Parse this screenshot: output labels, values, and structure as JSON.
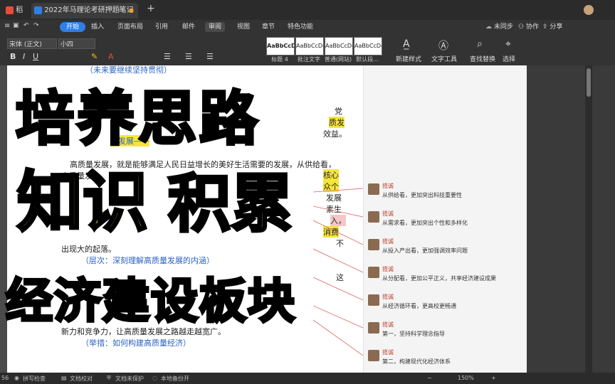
{
  "titlebar": {
    "home_tab": "稻壳",
    "doc_tab": "2022年马理论考研押题笔记",
    "new_tab": "+"
  },
  "menubar": {
    "items": [
      "开始",
      "插入",
      "页面布局",
      "引用",
      "邮件",
      "审阅",
      "视图",
      "章节",
      "特色功能"
    ],
    "right": {
      "sync": "未同步",
      "collab": "协作",
      "share": "分享"
    }
  },
  "toolbar": {
    "font_name": "宋体 (正文)",
    "font_size": "小四",
    "styles": [
      {
        "preview": "AaBbCcD",
        "label": "标题 4"
      },
      {
        "preview": "AaBbCcDd",
        "label": "批注文字"
      },
      {
        "preview": "AaBbCcDd",
        "label": "普通(网站)"
      },
      {
        "preview": "AaBbCcDd",
        "label": "默认段..."
      }
    ],
    "new_style": "新建样式",
    "text_tools": "文字工具",
    "find_replace": "查找替换",
    "select": "选择"
  },
  "document": {
    "line_top": "（未来要继续坚持贯彻）",
    "frag_right_1": "党",
    "frag_right_2": "质发",
    "frag_right_3": "效益。",
    "frag_blue_1": "量发展——",
    "para1": "高质量发展，就是能够满足人民日益增长的美好生活需要的发展，从供给看，",
    "frag_line_2": "高质量发",
    "frag_right_4": "核心",
    "frag_right_5": "众个",
    "frag_right_6": "发展",
    "frag_right_7": "素生",
    "frag_right_8": "入，",
    "frag_right_9": "消费",
    "frag_right_10": "不",
    "line_outgap": "出现大的起落。",
    "heading_level": "（层次：深刻理解高质量发展的内涵）",
    "frag_right_11": "这",
    "line_compete": "新力和竞争力，让高质量发展之路越走越宽广。",
    "heading_measure": "（举措：如何构建高质量经济）"
  },
  "comments": [
    {
      "author": "揽诚",
      "text": "从供给看，更加突出科技重要性"
    },
    {
      "author": "揽诚",
      "text": "从需求看，更加突出个性和多样化"
    },
    {
      "author": "揽诚",
      "text": "从投入产出看，更加强调效率问题"
    },
    {
      "author": "揽诚",
      "text": "从分配看，更加公平正义，共享经济建设成果"
    },
    {
      "author": "揽诚",
      "text": "从经济循环看，更高校更畅通"
    },
    {
      "author": "揽诚",
      "text": "第一，坚持科学理念指导"
    },
    {
      "author": "揽诚",
      "text": "第二，构建现代化经济体系"
    }
  ],
  "overlay": {
    "line1": "培养思路",
    "line2a": "知识",
    "line2b": "积累",
    "line3": "经济建设板块"
  },
  "statusbar": {
    "page": "56",
    "spellcheck": "拼写检查",
    "proof": "文档校对",
    "protect": "文档未保护",
    "backup": "本地备份开",
    "zoom": "150%"
  },
  "colors": {
    "accent": "#2f7fe8",
    "highlight": "#f6e63a",
    "comment_author": "#c0392b",
    "overlay_yellow": "#ffe500"
  }
}
